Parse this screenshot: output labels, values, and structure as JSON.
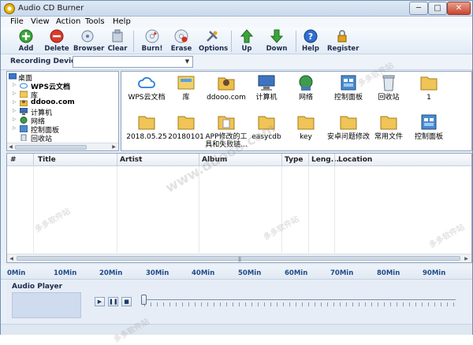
{
  "window": {
    "title": "Audio CD Burner",
    "min": "─",
    "max": "□",
    "close": "✕"
  },
  "menu": [
    "File",
    "View",
    "Action",
    "Tools",
    "Help"
  ],
  "toolbar": {
    "add": "Add",
    "delete": "Delete",
    "browser": "Browser",
    "clear": "Clear",
    "burn": "Burn!",
    "erase": "Erase",
    "options": "Options",
    "up": "Up",
    "down": "Down",
    "help": "Help",
    "register": "Register"
  },
  "device": {
    "label": "Recording Device",
    "value": ""
  },
  "tree": {
    "root": "桌面",
    "items": [
      "WPS云文档",
      "库",
      "ddooo.com",
      "计算机",
      "网络",
      "控制面板",
      "回收站"
    ]
  },
  "files": [
    {
      "label": "WPS云文档",
      "icon": "cloud-icon"
    },
    {
      "label": "库",
      "icon": "library-icon"
    },
    {
      "label": "ddooo.com",
      "icon": "user-folder-icon"
    },
    {
      "label": "计算机",
      "icon": "computer-icon"
    },
    {
      "label": "网络",
      "icon": "network-icon"
    },
    {
      "label": "控制面板",
      "icon": "control-panel-icon"
    },
    {
      "label": "回收站",
      "icon": "recycle-bin-icon"
    },
    {
      "label": "1",
      "icon": "folder-icon"
    },
    {
      "label": "2018.05.25",
      "icon": "folder-icon"
    },
    {
      "label": "20180101",
      "icon": "folder-icon"
    },
    {
      "label": "APP修改的工具和失败链...",
      "icon": "folder-icon"
    },
    {
      "label": "easycdb",
      "icon": "folder-icon"
    },
    {
      "label": "key",
      "icon": "folder-icon"
    },
    {
      "label": "安卓问题修改",
      "icon": "folder-icon"
    },
    {
      "label": "常用文件",
      "icon": "folder-icon"
    },
    {
      "label": "控制面板",
      "icon": "control-panel-icon"
    }
  ],
  "tracks": {
    "columns": [
      "#",
      "Title",
      "Artist",
      "Album",
      "Type",
      "Leng...",
      "Location"
    ]
  },
  "timeline": [
    "0Min",
    "10Min",
    "20Min",
    "30Min",
    "40Min",
    "50Min",
    "60Min",
    "70Min",
    "80Min",
    "90Min"
  ],
  "player": {
    "title": "Audio Player",
    "play": "▶",
    "pause": "❚❚",
    "stop": "■"
  },
  "watermarks": [
    "多多软件站",
    "www.ddooo.com"
  ]
}
